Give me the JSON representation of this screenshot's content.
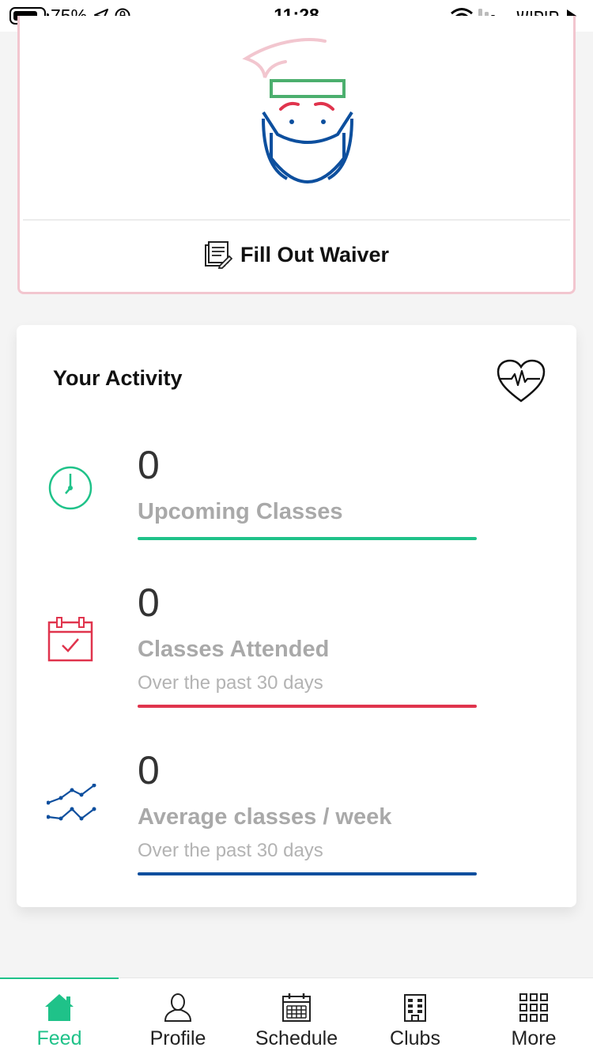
{
  "status_bar": {
    "battery_percent": "75%",
    "time": "11:28",
    "carrier": "חיפוש"
  },
  "waiver": {
    "button_label": "Fill Out Waiver",
    "colors": {
      "border": "#f2c6cf",
      "band": "#4caf6e",
      "brow": "#e0344d",
      "mask": "#0d4f9e"
    }
  },
  "activity": {
    "title": "Your Activity",
    "stats": [
      {
        "value": "0",
        "label": "Upcoming Classes",
        "sub": "",
        "color": "#1fc289",
        "icon": "clock-icon"
      },
      {
        "value": "0",
        "label": "Classes Attended",
        "sub": "Over the past 30 days",
        "color": "#e0344d",
        "icon": "calendar-check-icon"
      },
      {
        "value": "0",
        "label": "Average classes / week",
        "sub": "Over the past 30 days",
        "color": "#0d4f9e",
        "icon": "trend-lines-icon"
      }
    ]
  },
  "nav": {
    "active_color": "#1fc289",
    "items": [
      {
        "label": "Feed",
        "icon": "home-icon",
        "active": true
      },
      {
        "label": "Profile",
        "icon": "person-icon",
        "active": false
      },
      {
        "label": "Schedule",
        "icon": "calendar-icon",
        "active": false
      },
      {
        "label": "Clubs",
        "icon": "building-icon",
        "active": false
      },
      {
        "label": "More",
        "icon": "grid-icon",
        "active": false
      }
    ]
  }
}
